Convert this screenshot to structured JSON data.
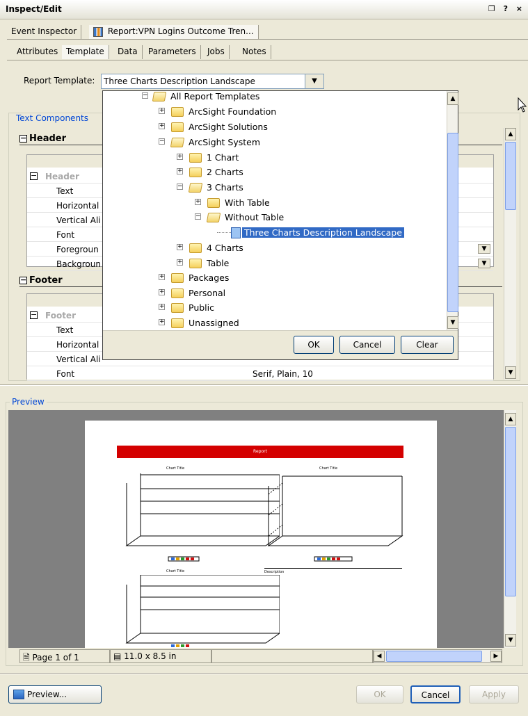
{
  "window": {
    "title": "Inspect/Edit",
    "controls": "❐ ? ×"
  },
  "editor_tabs": [
    "Event Inspector",
    "Report:VPN Logins Outcome Tren..."
  ],
  "section_tabs": [
    "Attributes",
    "Template",
    "Data",
    "Parameters",
    "Jobs",
    "Notes"
  ],
  "active_section_tab": "Template",
  "report_template": {
    "label": "Report Template:",
    "value": "Three Charts Description Landscape"
  },
  "text_components": {
    "title": "Text Components",
    "header": {
      "heading": "Header",
      "group_label": "Header",
      "rows": [
        "Text",
        "Horizontal",
        "Vertical Ali",
        "Font",
        "Foregroun",
        "Backgroun"
      ]
    },
    "footer": {
      "heading": "Footer",
      "group_label": "Footer",
      "rows": [
        "Text",
        "Horizontal",
        "Vertical Ali",
        "Font"
      ],
      "font_value": "Serif, Plain, 10"
    }
  },
  "tree": {
    "root": "All Report Templates",
    "nodes": [
      {
        "label": "ArcSight Foundation"
      },
      {
        "label": "ArcSight Solutions"
      },
      {
        "label": "ArcSight System"
      },
      {
        "label": "1 Chart"
      },
      {
        "label": "2 Charts"
      },
      {
        "label": "3 Charts"
      },
      {
        "label": "With Table"
      },
      {
        "label": "Without Table"
      },
      {
        "label": "Three Charts Description Landscape"
      },
      {
        "label": "4 Charts"
      },
      {
        "label": "Table"
      },
      {
        "label": "Packages"
      },
      {
        "label": "Personal"
      },
      {
        "label": "Public"
      },
      {
        "label": "Unassigned"
      }
    ],
    "buttons": {
      "ok": "OK",
      "cancel": "Cancel",
      "clear": "Clear"
    }
  },
  "preview": {
    "title": "Preview",
    "report_banner": "Report",
    "chart_titles": [
      "Chart Title",
      "Chart Title",
      "Chart Title"
    ],
    "description_label": "Description",
    "status": {
      "page": "Page 1 of 1",
      "size": "11.0 x 8.5 in"
    }
  },
  "bottom_buttons": {
    "preview": "Preview...",
    "ok": "OK",
    "cancel": "Cancel",
    "apply": "Apply"
  }
}
